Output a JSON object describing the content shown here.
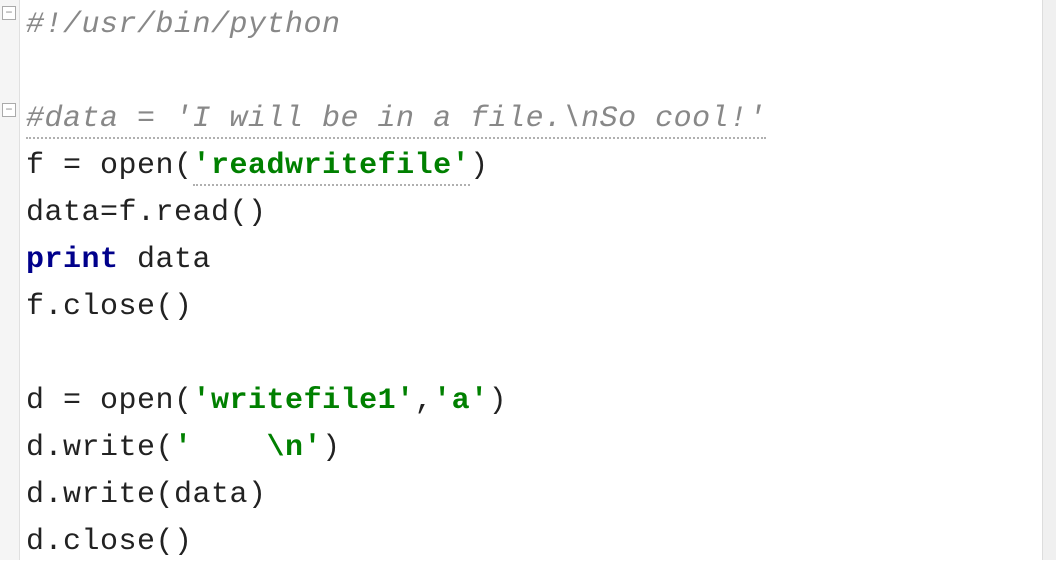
{
  "editor": {
    "lines": [
      {
        "type": "comment",
        "segments": [
          {
            "text": "#!/usr/bin/python",
            "cls": "comment"
          }
        ]
      },
      {
        "type": "blank",
        "segments": []
      },
      {
        "type": "comment",
        "segments": [
          {
            "text": "#data = 'I will be in a file.\\nSo cool!'",
            "cls": "comment underline-wave"
          }
        ]
      },
      {
        "type": "code",
        "segments": [
          {
            "text": "f = ",
            "cls": "plain"
          },
          {
            "text": "open",
            "cls": "builtin"
          },
          {
            "text": "(",
            "cls": "plain"
          },
          {
            "text": "'readwritefile'",
            "cls": "string underline-wave"
          },
          {
            "text": ")",
            "cls": "plain"
          }
        ]
      },
      {
        "type": "code",
        "segments": [
          {
            "text": "data=f.read()",
            "cls": "plain"
          }
        ]
      },
      {
        "type": "code",
        "segments": [
          {
            "text": "print ",
            "cls": "keyword"
          },
          {
            "text": "data",
            "cls": "plain"
          }
        ]
      },
      {
        "type": "code",
        "segments": [
          {
            "text": "f.close()",
            "cls": "plain"
          }
        ]
      },
      {
        "type": "blank",
        "segments": []
      },
      {
        "type": "code",
        "segments": [
          {
            "text": "d = ",
            "cls": "plain"
          },
          {
            "text": "open",
            "cls": "builtin"
          },
          {
            "text": "(",
            "cls": "plain"
          },
          {
            "text": "'writefile1'",
            "cls": "string"
          },
          {
            "text": ",",
            "cls": "plain"
          },
          {
            "text": "'a'",
            "cls": "string"
          },
          {
            "text": ")",
            "cls": "plain"
          }
        ]
      },
      {
        "type": "code",
        "segments": [
          {
            "text": "d.write(",
            "cls": "plain"
          },
          {
            "text": "'    \\n'",
            "cls": "string"
          },
          {
            "text": ")",
            "cls": "plain"
          }
        ]
      },
      {
        "type": "code",
        "segments": [
          {
            "text": "d.write(data)",
            "cls": "plain"
          }
        ]
      },
      {
        "type": "code",
        "segments": [
          {
            "text": "d.close()",
            "cls": "plain"
          }
        ]
      }
    ],
    "fold_markers": {
      "glyph": "−"
    }
  }
}
